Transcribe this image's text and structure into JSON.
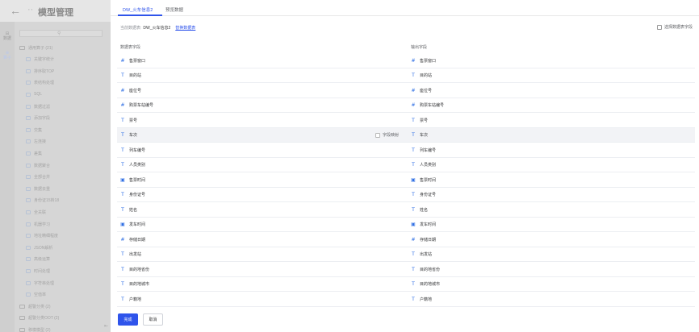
{
  "header": {
    "back_arrow": "←",
    "title": "模型管理"
  },
  "icon_strip": [
    {
      "label": "数据",
      "icon": "database-icon"
    },
    {
      "label": "算子",
      "icon": "operator-icon"
    }
  ],
  "tree": {
    "search_icon": "search-icon",
    "nodes": [
      {
        "label": "通用算子 (21)",
        "type": "folder",
        "level": 0
      },
      {
        "label": "关键字统计",
        "type": "op",
        "level": 1
      },
      {
        "label": "排序取TOP",
        "type": "op",
        "level": 1
      },
      {
        "label": "表结构处理",
        "type": "op",
        "level": 1
      },
      {
        "label": "SQL",
        "type": "op",
        "level": 1
      },
      {
        "label": "数据过滤",
        "type": "op",
        "level": 1
      },
      {
        "label": "添加字段",
        "type": "op",
        "level": 1
      },
      {
        "label": "交集",
        "type": "op",
        "level": 1
      },
      {
        "label": "左连接",
        "type": "op",
        "level": 1
      },
      {
        "label": "差集",
        "type": "op",
        "level": 1
      },
      {
        "label": "数据聚合",
        "type": "op",
        "level": 1
      },
      {
        "label": "全部合并",
        "type": "op",
        "level": 1
      },
      {
        "label": "数据去重",
        "type": "op",
        "level": 1
      },
      {
        "label": "身份证15转18",
        "type": "op",
        "level": 1
      },
      {
        "label": "全关联",
        "type": "op",
        "level": 1
      },
      {
        "label": "机器学习",
        "type": "op",
        "level": 1
      },
      {
        "label": "地址精细程度",
        "type": "op",
        "level": 1
      },
      {
        "label": "JSON解析",
        "type": "op",
        "level": 1
      },
      {
        "label": "高级运算",
        "type": "op",
        "level": 1
      },
      {
        "label": "时间处理",
        "type": "op",
        "level": 1
      },
      {
        "label": "字符串处理",
        "type": "op",
        "level": 1
      },
      {
        "label": "空值率",
        "type": "op",
        "level": 1
      },
      {
        "label": "超警分类 (2)",
        "type": "folder",
        "level": 0
      },
      {
        "label": "超警分类OOT (2)",
        "type": "folder",
        "level": 0
      },
      {
        "label": "移模模型 (2)",
        "type": "folder",
        "level": 0
      }
    ],
    "collapse_icon": "collapse-panel-icon"
  },
  "tabs": [
    {
      "label": "DW_火车信息2",
      "active": true
    },
    {
      "label": "预览数据",
      "active": false
    }
  ],
  "source": {
    "label": "当前数据表:",
    "value": "DW_火车信息2",
    "change_link": "替换数据表"
  },
  "select_columns": "选择数据表字段",
  "columns": {
    "left": "数据表字段",
    "right": "输出字段"
  },
  "mapping_label": "字段映射",
  "rows": [
    {
      "type": "num",
      "field": "售票窗口",
      "output": "售票窗口",
      "highlight": false
    },
    {
      "type": "text",
      "field": "目的站",
      "output": "目的站",
      "highlight": false
    },
    {
      "type": "num",
      "field": "座位号",
      "output": "座位号",
      "highlight": false
    },
    {
      "type": "num",
      "field": "购票车站编号",
      "output": "购票车站编号",
      "highlight": false
    },
    {
      "type": "text",
      "field": "票号",
      "output": "票号",
      "highlight": false
    },
    {
      "type": "text",
      "field": "车次",
      "output": "车次",
      "highlight": true
    },
    {
      "type": "text",
      "field": "列车编号",
      "output": "列车编号",
      "highlight": false
    },
    {
      "type": "text",
      "field": "人员类别",
      "output": "人员类别",
      "highlight": false
    },
    {
      "type": "date",
      "field": "售票时间",
      "output": "售票时间",
      "highlight": false
    },
    {
      "type": "text",
      "field": "身份证号",
      "output": "身份证号",
      "highlight": false
    },
    {
      "type": "text",
      "field": "姓名",
      "output": "姓名",
      "highlight": false
    },
    {
      "type": "date",
      "field": "发车时间",
      "output": "发车时间",
      "highlight": false
    },
    {
      "type": "num",
      "field": "存储日期",
      "output": "存储日期",
      "highlight": false
    },
    {
      "type": "text",
      "field": "出发站",
      "output": "出发站",
      "highlight": false
    },
    {
      "type": "text",
      "field": "目的地省份",
      "output": "目的地省份",
      "highlight": false
    },
    {
      "type": "text",
      "field": "目的地城市",
      "output": "目的地城市",
      "highlight": false
    },
    {
      "type": "text",
      "field": "户籍地",
      "output": "户籍地",
      "highlight": false
    }
  ],
  "type_glyphs": {
    "num": "#",
    "text": "T",
    "date": "▣"
  },
  "buttons": {
    "confirm": "完成",
    "cancel": "取消"
  },
  "colors": {
    "accent": "#2f54eb",
    "type_icon": "#2f6fe4",
    "overlay": "#d3d3d3"
  }
}
